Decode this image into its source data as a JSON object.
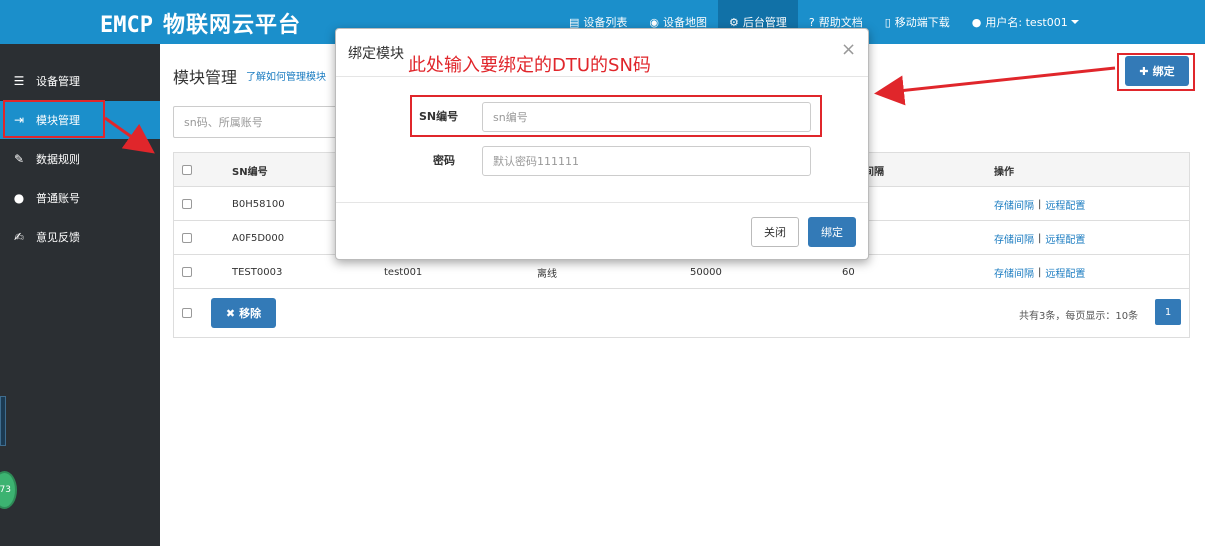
{
  "brand": {
    "logo_mark": "EMCP",
    "title": "物联网云平台"
  },
  "nav": [
    {
      "icon": "list-icon",
      "label": "设备列表"
    },
    {
      "icon": "globe-icon",
      "label": "设备地图"
    },
    {
      "icon": "gears-icon",
      "label": "后台管理"
    },
    {
      "icon": "question-icon",
      "label": "帮助文档"
    },
    {
      "icon": "mobile-icon",
      "label": "移动端下载"
    },
    {
      "icon": "user-icon",
      "label": "用户名: test001"
    }
  ],
  "sidebar": {
    "items": [
      {
        "icon": "list-icon",
        "label": "设备管理"
      },
      {
        "icon": "sign-in-icon",
        "label": "模块管理"
      },
      {
        "icon": "pencil-icon",
        "label": "数据规则"
      },
      {
        "icon": "user-icon",
        "label": "普通账号"
      },
      {
        "icon": "edit-icon",
        "label": "意见反馈"
      }
    ],
    "bubble_text": "73"
  },
  "main": {
    "title": "模块管理",
    "help_link": "了解如何管理模块",
    "search_placeholder": "sn码、所属账号",
    "bind_button": "绑定",
    "table": {
      "columns": [
        "SN编号",
        "",
        "",
        "",
        "间隔",
        "操作"
      ],
      "rows": [
        {
          "sn": "B0H58100",
          "account": "",
          "status": "",
          "value": "",
          "interval": "",
          "op_store": "存储间隔",
          "op_remote": "远程配置"
        },
        {
          "sn": "A0F5D000",
          "account": "",
          "status": "",
          "value": "",
          "interval": "",
          "op_store": "存储间隔",
          "op_remote": "远程配置"
        },
        {
          "sn": "TEST0003",
          "account": "test001",
          "status": "离线",
          "value": "50000",
          "interval": "60",
          "op_store": "存储间隔",
          "op_remote": "远程配置"
        }
      ],
      "op_separator": "|"
    },
    "remove_button": "移除",
    "page_info": "共有3条，每页显示：10条",
    "current_page": "1"
  },
  "modal": {
    "title": "绑定模块",
    "close_symbol": "×",
    "sn_label": "SN编号",
    "sn_placeholder": "sn编号",
    "password_label": "密码",
    "password_placeholder": "默认密码111111",
    "close_button": "关闭",
    "bind_button": "绑定"
  },
  "annotation": {
    "text": "此处输入要绑定的DTU的SN码",
    "color": "#e0262b"
  },
  "colors": {
    "topbar": "#1b8fcb",
    "sidebar": "#2b2f33",
    "primary": "#337ab7",
    "link": "#1b7cc1"
  }
}
